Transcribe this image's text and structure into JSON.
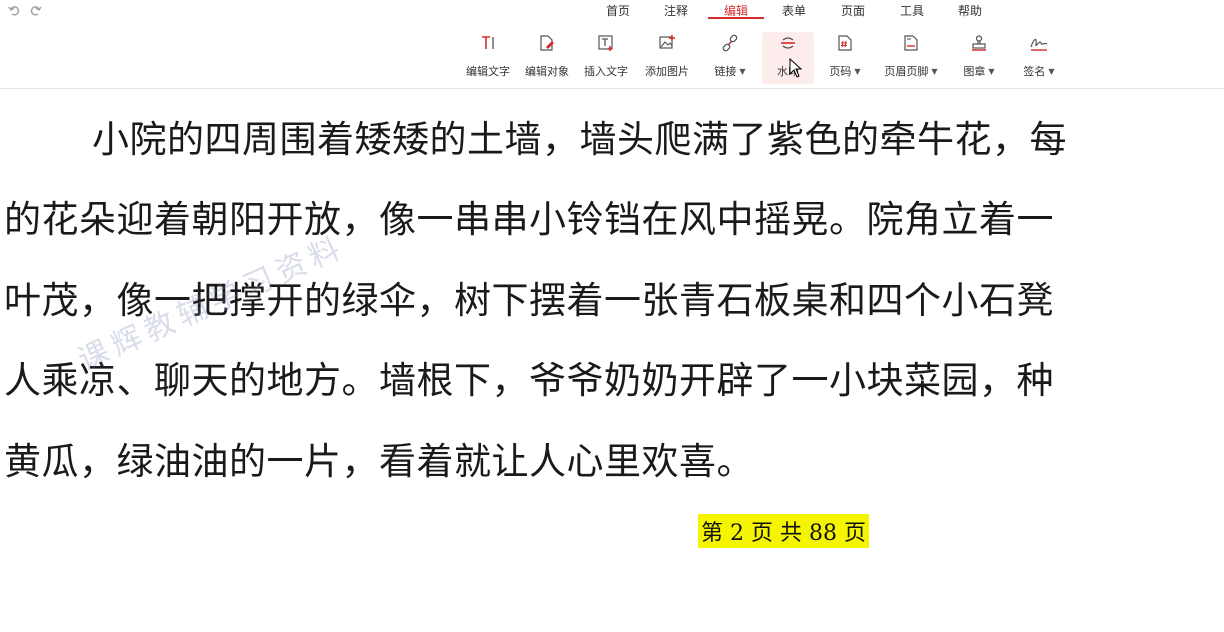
{
  "menu": {
    "tabs": [
      {
        "label": "首页"
      },
      {
        "label": "注释"
      },
      {
        "label": "编辑"
      },
      {
        "label": "表单"
      },
      {
        "label": "页面"
      },
      {
        "label": "工具"
      },
      {
        "label": "帮助"
      }
    ],
    "active_tab": "编辑"
  },
  "ribbon": {
    "tools": [
      {
        "label": "编辑文字",
        "icon": "edit-text-icon"
      },
      {
        "label": "编辑对象",
        "icon": "edit-object-icon"
      },
      {
        "label": "插入文字",
        "icon": "insert-text-icon"
      },
      {
        "label": "添加图片",
        "icon": "add-image-icon"
      },
      {
        "label": "链接",
        "icon": "link-icon"
      },
      {
        "label": "水印",
        "icon": "watermark-icon"
      },
      {
        "label": "页码",
        "icon": "page-number-icon"
      },
      {
        "label": "页眉页脚",
        "icon": "header-footer-icon"
      },
      {
        "label": "图章",
        "icon": "stamp-icon"
      },
      {
        "label": "签名",
        "icon": "signature-icon"
      }
    ],
    "accent_color": "#d42c2c"
  },
  "document": {
    "lines": [
      "小院的四周围着矮矮的土墙，墙头爬满了紫色的牵牛花，每",
      "的花朵迎着朝阳开放，像一串串小铃铛在风中摇晃。院角立着一",
      "叶茂，像一把撑开的绿伞，树下摆着一张青石板桌和四个小石凳",
      "人乘凉、聊天的地方。墙根下，爷爷奶奶开辟了一小块菜园，种",
      "黄瓜，绿油油的一片，看着就让人心里欢喜。"
    ],
    "watermark": "课辉教辅学习资料",
    "page_number": "第 2 页 共 88 页",
    "page_number_highlight": "#f5f500"
  }
}
